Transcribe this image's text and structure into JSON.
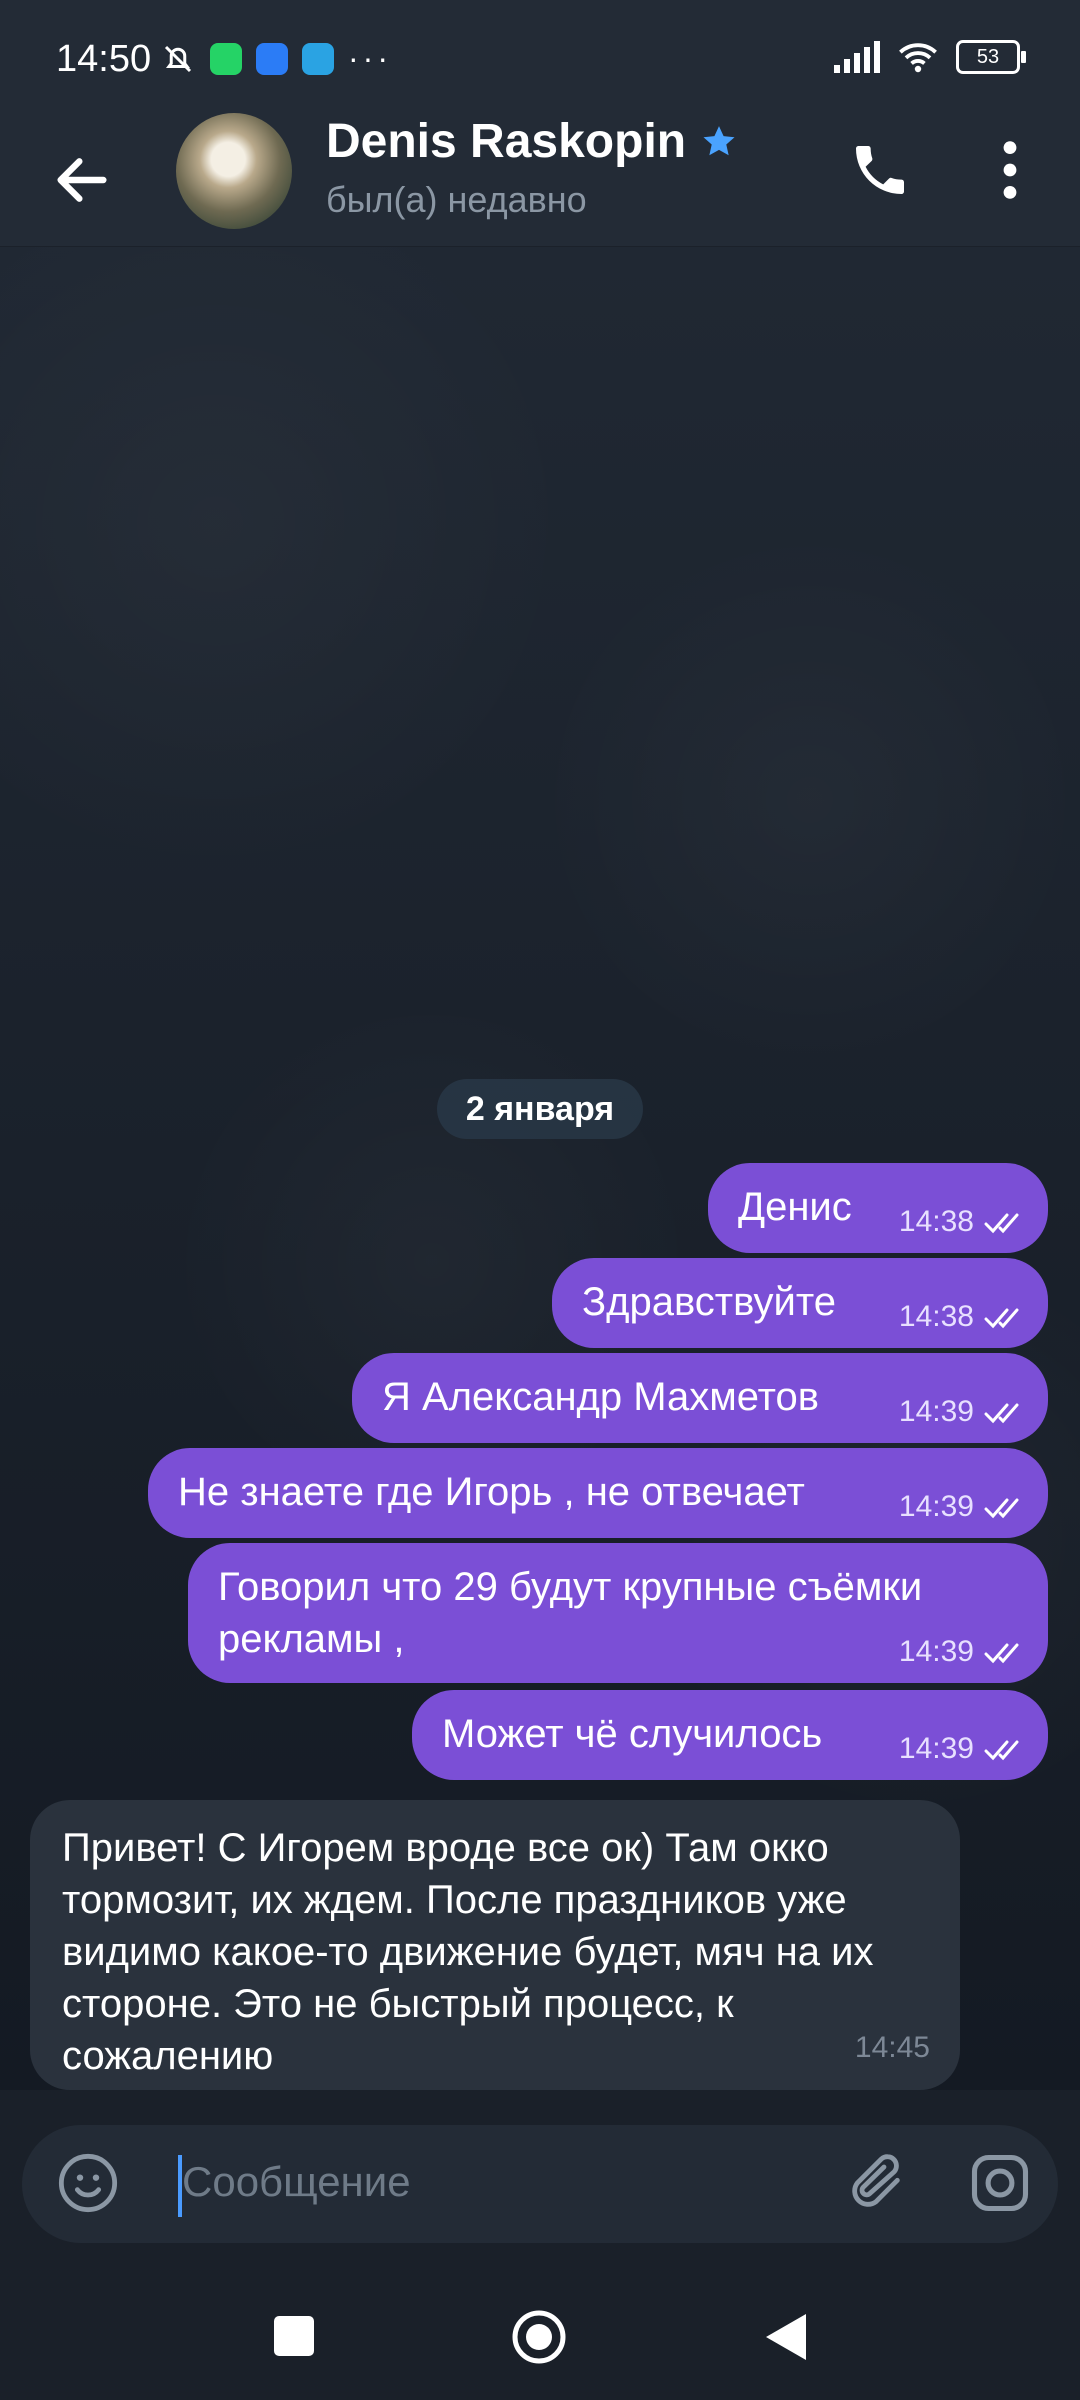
{
  "status_bar": {
    "time": "14:50",
    "battery": "53",
    "icons": [
      "mute-bell-icon",
      "whatsapp-icon",
      "messages-icon",
      "telegram-icon",
      "more-dots-icon",
      "signal-icon",
      "wifi-icon",
      "battery-icon"
    ]
  },
  "header": {
    "name": "Denis Raskopin",
    "status": "был(а) недавно",
    "icons": [
      "back-arrow-icon",
      "star-icon",
      "phone-icon",
      "more-vert-icon"
    ]
  },
  "chat": {
    "date_label": "2 января",
    "outgoing": [
      {
        "text": "Денис",
        "time": "14:38"
      },
      {
        "text": "Здравствуйте",
        "time": "14:38"
      },
      {
        "text": "Я Александр Махметов",
        "time": "14:39"
      },
      {
        "text": "Не знаете где Игорь , не отвечает",
        "time": "14:39"
      },
      {
        "text": "Говорил что 29 будут крупные съёмки рекламы ,",
        "time": "14:39"
      },
      {
        "text": "Может чё случилось",
        "time": "14:39"
      }
    ],
    "incoming": {
      "text": "Привет! С Игорем вроде все ок) Там окко тормозит, их ждем. После праздников уже видимо какое-то движение будет, мяч на их стороне. Это не быстрый процесс, к сожалению",
      "time": "14:45"
    }
  },
  "input": {
    "placeholder": "Сообщение",
    "icons": [
      "emoji-icon",
      "attach-icon",
      "camera-icon"
    ]
  },
  "colors": {
    "outgoing_bubble": "#7b4fd6",
    "incoming_bubble": "#2a323d",
    "header_bg": "#232b36",
    "verified_star": "#4aa3ff"
  }
}
